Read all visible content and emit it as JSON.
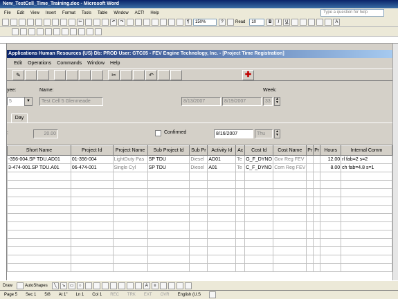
{
  "word": {
    "title": "New_TestCell_Time_Training.doc - Microsoft Word",
    "menu": [
      "File",
      "Edit",
      "View",
      "Insert",
      "Format",
      "Tools",
      "Table",
      "Window",
      "ACT!",
      "Help"
    ],
    "help_placeholder": "Type a question for help",
    "zoom": "150%",
    "read_label": "Read",
    "font_size": "10",
    "style_buttons": [
      "B",
      "I",
      "U"
    ]
  },
  "app": {
    "title": "Applications Human Resources (US)  Db: PROD  User: GTC05 - FEV Engine Technology, Inc. - [Project Time Registration]",
    "menu": [
      "Edit",
      "Operations",
      "Commands",
      "Window",
      "Help"
    ],
    "labels": {
      "employee": "yee:",
      "name": "Name:",
      "week": "Week:",
      "confirmed": "Confirmed"
    },
    "employee_id": "5",
    "employee_name": "Test Cell 5 Glenmeade",
    "week_start": "8/13/2007",
    "week_end": "8/19/2007",
    "week_number": "33",
    "tab": "Day",
    "hours_total": "20.00",
    "day_date": "8/16/2007",
    "day_name": "Thu",
    "colon": ":"
  },
  "grid": {
    "headers": [
      "Short Name",
      "Project Id",
      "Project Name",
      "Sub Project Id",
      "Sub Pr",
      "Activity Id",
      "Ac",
      "Cost Id",
      "Cost Name",
      "Pr",
      "Pr",
      "Hours",
      "Internal Comm"
    ],
    "rows": [
      [
        "-356-004.SP TDU.AD01",
        "01-356-004",
        "LightDuty Pas",
        "SP TDU",
        "Diesel",
        "AD01",
        "Te",
        "G_F_DYNO",
        "Gov Reg FEV",
        "",
        "",
        "12.00",
        "rl fab=2 s=2"
      ],
      [
        "3-474-001.SP TDU.A01",
        "06-474-001",
        "Single Cyl",
        "SP TDU",
        "Diesel",
        "A01",
        "Te",
        "C_F_DYNO",
        "Com Reg FEV",
        "",
        "",
        "8.00",
        "ch fab=4.8 s=1"
      ]
    ]
  },
  "status": {
    "page": "Page 5",
    "sec": "Sec 1",
    "pages": "5/8",
    "at": "At 1\"",
    "ln": "Ln 1",
    "col": "Col 1",
    "rec": "REC",
    "trk": "TRK",
    "ext": "EXT",
    "ovr": "OVR",
    "language": "English (U.S"
  },
  "draw": {
    "draw_label": "Draw",
    "autoshapes_label": "AutoShapes"
  }
}
